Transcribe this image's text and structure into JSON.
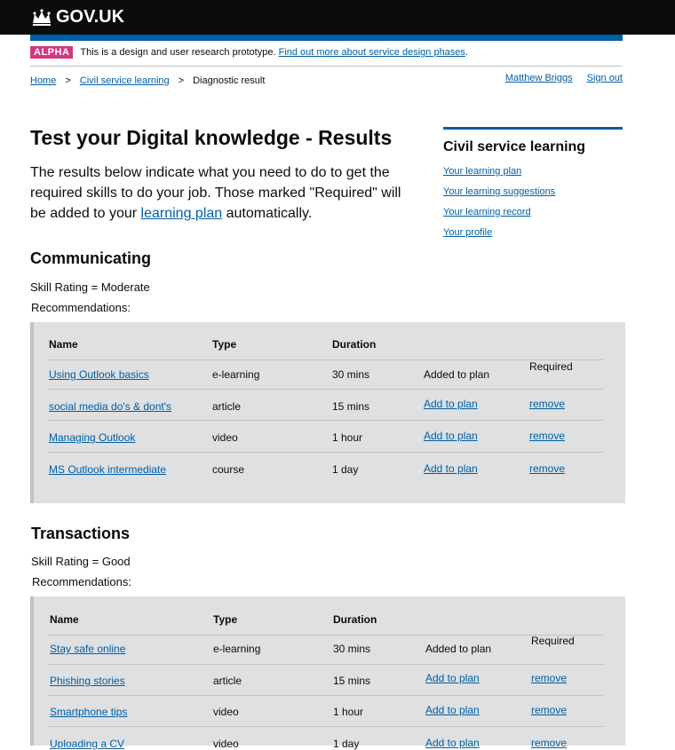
{
  "header": {
    "logo_text": "GOV.UK",
    "logo_icon": "crown-icon"
  },
  "phase": {
    "tag": "ALPHA",
    "text": "This is a design and user research prototype.",
    "link": "Find out more about service design phases",
    "after": "."
  },
  "breadcrumbs": {
    "home": "Home",
    "sep": ">",
    "csl": "Civil service learning",
    "current": "Diagnostic result"
  },
  "user": {
    "name": "Matthew Briggs",
    "sign_out": "Sign out"
  },
  "page": {
    "title": "Test your Digital knowledge - Results",
    "intro_before": "The results below indicate what you need to do to get the required skills to do your job. Those marked \"Required\" will be added to your",
    "intro_link": "learning plan",
    "intro_after": "automatically."
  },
  "aside": {
    "title": "Civil service learning",
    "links": [
      "Your learning plan",
      "Your learning suggestions",
      "Your learning record",
      "Your profile"
    ]
  },
  "columns": {
    "name": "Name",
    "type": "Type",
    "duration": "Duration"
  },
  "sections": [
    {
      "title": "Communicating",
      "rating": "Skill Rating = Moderate",
      "recommendations_label": "Recommendations:",
      "rows": [
        {
          "name": "Using Outlook basics",
          "type": "e-learning",
          "duration": "30 mins",
          "status": "Added to plan",
          "extra": "Required"
        },
        {
          "name": "social media do's & dont's",
          "type": "article",
          "duration": "15 mins",
          "add": "Add to plan",
          "remove": "remove"
        },
        {
          "name": "Managing Outlook",
          "type": "video",
          "duration": "1 hour",
          "add": "Add to plan",
          "remove": "remove"
        },
        {
          "name": "MS Outlook intermediate",
          "type": "course",
          "duration": "1 day",
          "add": "Add to plan",
          "remove": "remove"
        }
      ]
    },
    {
      "title": "Transactions",
      "rating": "Skill Rating = Good",
      "recommendations_label": "Recommendations:",
      "rows": [
        {
          "name": "Stay safe online",
          "type": "e-learning",
          "duration": "30 mins",
          "status": "Added to plan",
          "extra": "Required"
        },
        {
          "name": "Phishing stories",
          "type": "article",
          "duration": "15 mins",
          "add": "Add to plan",
          "remove": "remove"
        },
        {
          "name": "Smartphone tips",
          "type": "video",
          "duration": "1 hour",
          "add": "Add to plan",
          "remove": "remove"
        },
        {
          "name": "Uploading a CV",
          "type": "video",
          "duration": "1 day",
          "add": "Add to plan",
          "remove": "remove"
        }
      ]
    }
  ]
}
